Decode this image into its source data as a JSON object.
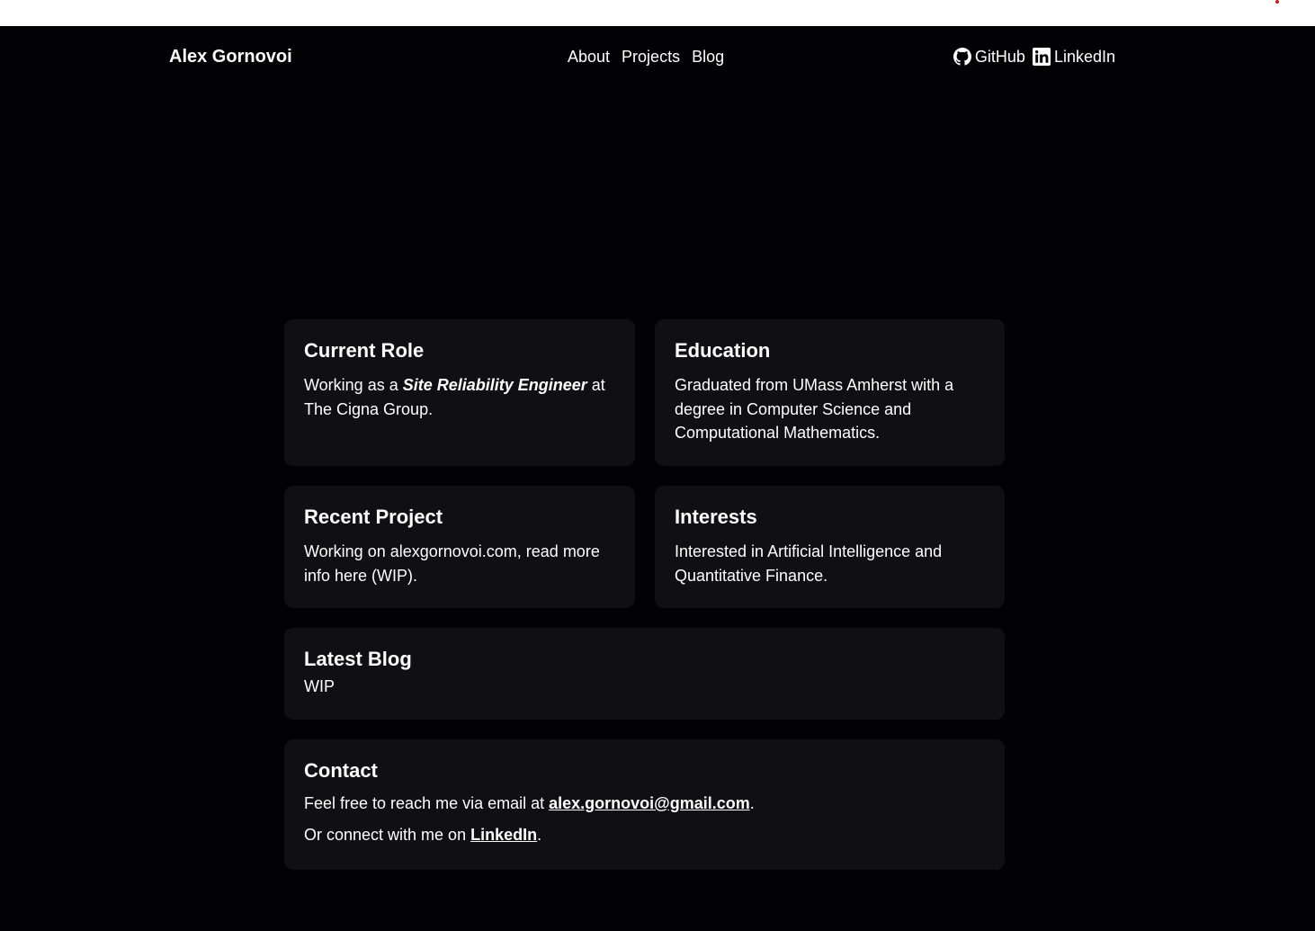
{
  "nav": {
    "brand": "Alex Gornovoi",
    "links": [
      "About",
      "Projects",
      "Blog"
    ],
    "github_label": "GitHub",
    "linkedin_label": "LinkedIn",
    "github_icon": "github-icon",
    "linkedin_icon": "linkedin-icon"
  },
  "cards": {
    "current_role": {
      "title": "Current Role",
      "text_before": "Working as a ",
      "emphasis": "Site Reliability Engineer",
      "text_after": " at The Cigna Group."
    },
    "education": {
      "title": "Education",
      "text": "Graduated from UMass Amherst with a degree in Computer Science and Computational Mathematics."
    },
    "recent_project": {
      "title": "Recent Project",
      "text": "Working on alexgornovoi.com, read more info here (WIP)."
    },
    "interests": {
      "title": "Interests",
      "text": "Interested in Artificial Intelligence and Quantitative Finance."
    },
    "latest_blog": {
      "title": "Latest Blog",
      "text": "WIP"
    },
    "contact": {
      "title": "Contact",
      "email_prefix": "Feel free to reach me via email at ",
      "email": "alex.gornovoi@gmail.com",
      "email_suffix": ".",
      "linkedin_prefix": "Or connect with me on ",
      "linkedin_link": "LinkedIn",
      "linkedin_suffix": "."
    }
  },
  "colors": {
    "background": "#020205",
    "card": "#101014",
    "text": "#ffffff"
  }
}
